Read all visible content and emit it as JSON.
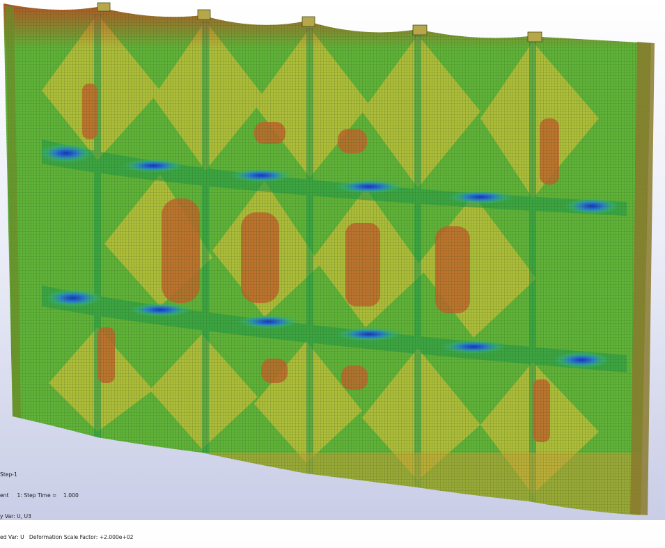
{
  "viewport": {
    "model": "deformed-shell-wall-contour",
    "background_top": "#ffffff",
    "background_bottom": "#c9cde6",
    "contour_colors": {
      "max": "#cf3a1f",
      "high": "#d6ca2e",
      "mid": "#6fb83a",
      "low": "#1f9a4a",
      "min": "#1633c8"
    },
    "mesh_color": "#2a4a1a"
  },
  "state_block": {
    "line1": "Step-1",
    "line2": "ent     1: Step Time =    1.000",
    "line3": "y Var: U, U3",
    "line4": "ed Var: U   Deformation Scale Factor: +2.000e+02"
  }
}
